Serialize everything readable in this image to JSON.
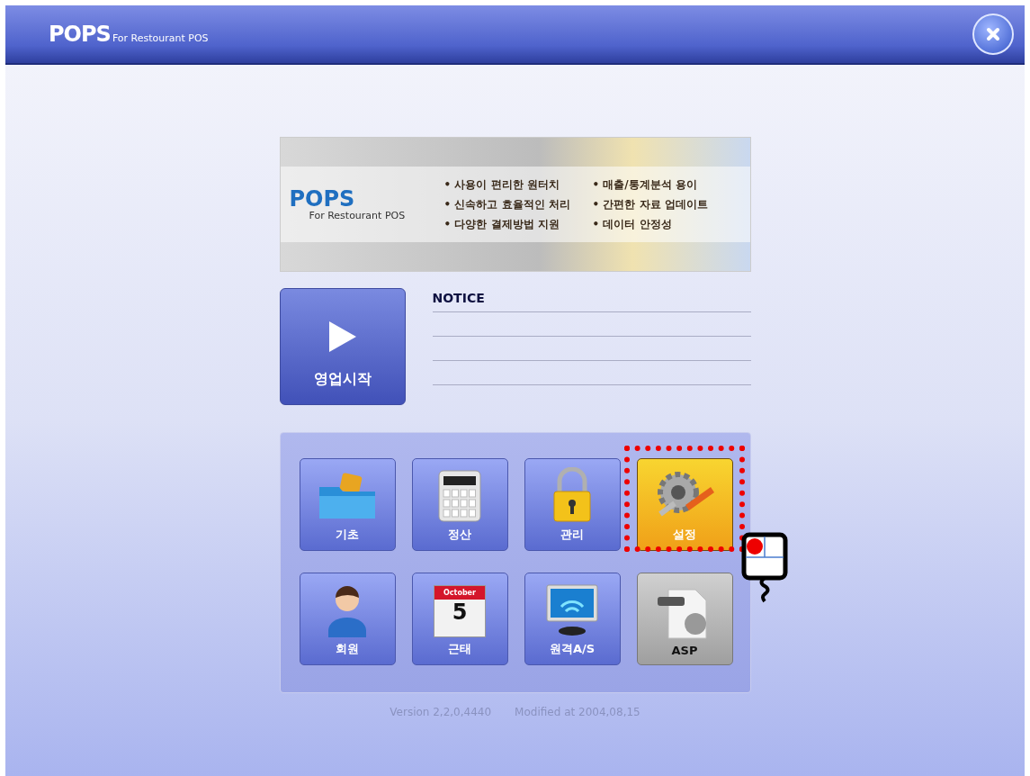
{
  "header": {
    "logo": "POPS",
    "logo_sub": "For Restourant POS"
  },
  "banner": {
    "logo": "POPS",
    "logo_sub": "For Restourant POS",
    "features": [
      "• 사용이 편리한 원터치",
      "• 매출/통계분석 용이",
      "• 신속하고 효율적인 처리",
      "• 간편한 자료 업데이트",
      "• 다양한 결제방법 지원",
      "• 데이터 안정성"
    ]
  },
  "start_button": {
    "label": "영업시작"
  },
  "notice": {
    "title": "NOTICE"
  },
  "tiles": [
    {
      "label": "기초",
      "kind": "folder",
      "selected": false,
      "disabled": false
    },
    {
      "label": "정산",
      "kind": "calculator",
      "selected": false,
      "disabled": false
    },
    {
      "label": "관리",
      "kind": "lock",
      "selected": false,
      "disabled": false
    },
    {
      "label": "설정",
      "kind": "gear",
      "selected": true,
      "disabled": false
    },
    {
      "label": "회원",
      "kind": "person",
      "selected": false,
      "disabled": false
    },
    {
      "label": "근태",
      "kind": "calendar",
      "month": "October",
      "day": "5",
      "selected": false,
      "disabled": false
    },
    {
      "label": "원격A/S",
      "kind": "monitor",
      "selected": false,
      "disabled": false
    },
    {
      "label": "ASP",
      "kind": "document",
      "selected": false,
      "disabled": true
    }
  ],
  "footer": {
    "version": "Version 2,2,0,4440",
    "modified": "Modified at 2004,08,15"
  }
}
